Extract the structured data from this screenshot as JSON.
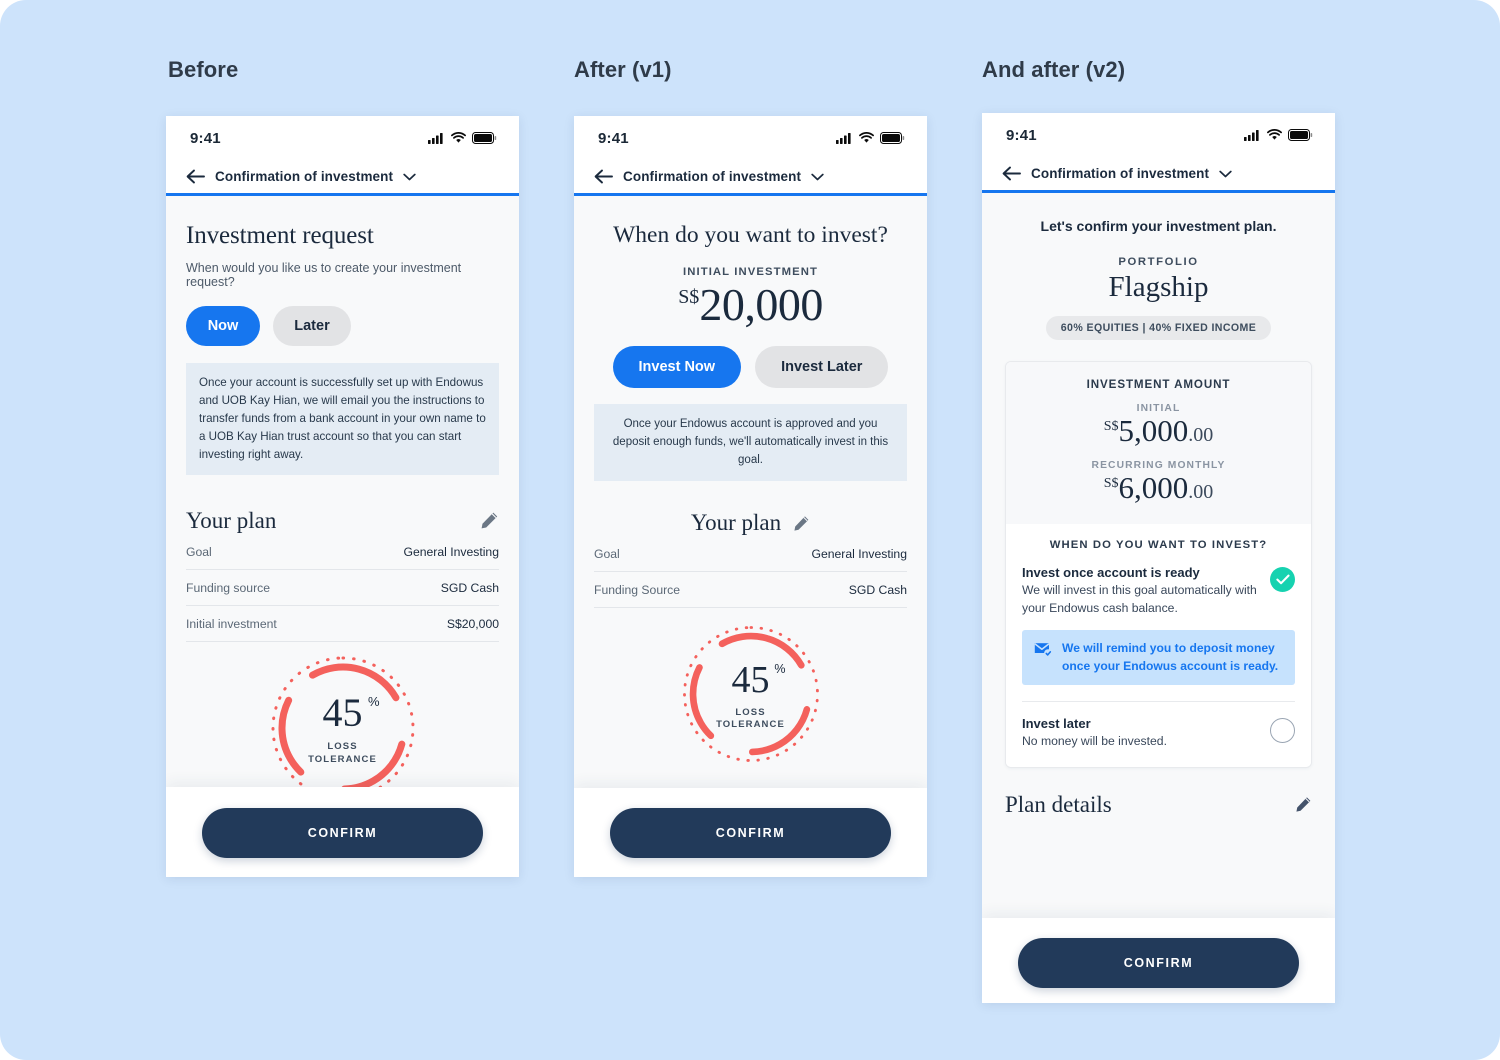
{
  "captions": {
    "before": "Before",
    "after_v1": "After (v1)",
    "after_v2": "And after (v2)"
  },
  "colors": {
    "page_background": "#cde3fb",
    "accent_blue": "#1676ef",
    "dark_navy": "#223a5a",
    "text_navy": "#1b2a3d",
    "dial_red": "#f4615c",
    "success_teal": "#16d2b0",
    "info_grey": "#e4ecf4",
    "remind_blue": "#c6e2fd"
  },
  "statusbar": {
    "time": "9:41",
    "icons": [
      "cellular-signal-icon",
      "wifi-icon",
      "battery-icon"
    ]
  },
  "navbar": {
    "back_icon": "back-arrow-icon",
    "title": "Confirmation of investment",
    "chevron_icon": "chevron-down-icon"
  },
  "phone1": {
    "heading": "Investment request",
    "subheading": "When would you like us to create your investment request?",
    "segments": [
      {
        "label": "Now",
        "selected": true
      },
      {
        "label": "Later",
        "selected": false
      }
    ],
    "info_text": "Once your account is successfully set up with Endowus and UOB Kay Hian, we will email you the instructions to transfer funds from a bank account in your own name to a UOB Kay Hian trust account so that you can start investing right away.",
    "plan_title": "Your plan",
    "edit_icon": "pencil-icon",
    "rows": [
      {
        "key": "Goal",
        "value": "General Investing"
      },
      {
        "key": "Funding source",
        "value": "SGD Cash"
      },
      {
        "key": "Initial investment",
        "value": "S$20,000"
      }
    ],
    "dial": {
      "value": "45",
      "unit": "%",
      "label_line1": "LOSS",
      "label_line2": "TOLERANCE"
    },
    "confirm_label": "CONFIRM"
  },
  "phone2": {
    "question": "When do you want to invest?",
    "amount_kicker": "INITIAL INVESTMENT",
    "amount_currency": "S$",
    "amount_value": "20,000",
    "segments": [
      {
        "label": "Invest Now",
        "selected": true
      },
      {
        "label": "Invest Later",
        "selected": false
      }
    ],
    "info_text": "Once your Endowus account is approved and you deposit enough funds, we'll automatically invest in this goal.",
    "plan_title": "Your plan",
    "edit_icon": "pencil-icon",
    "rows": [
      {
        "key": "Goal",
        "value": "General Investing"
      },
      {
        "key": "Funding Source",
        "value": "SGD Cash"
      }
    ],
    "dial": {
      "value": "45",
      "unit": "%",
      "label_line1": "LOSS",
      "label_line2": "TOLERANCE"
    },
    "confirm_label": "CONFIRM"
  },
  "phone3": {
    "lead": "Let's confirm your investment plan.",
    "portfolio_kicker": "PORTFOLIO",
    "portfolio_name": "Flagship",
    "allocation_chip": "60% EQUITIES | 40% FIXED INCOME",
    "amount_card_title": "INVESTMENT AMOUNT",
    "initial_label": "INITIAL",
    "initial_currency": "S$",
    "initial_value": "5,000",
    "initial_cents": ".00",
    "recurring_label": "RECURRING MONTHLY",
    "recurring_currency": "S$",
    "recurring_value": "6,000",
    "recurring_cents": ".00",
    "when_title": "WHEN DO YOU WANT TO INVEST?",
    "option_ready": {
      "title": "Invest once account is ready",
      "desc": "We will invest in this goal automatically with your Endowus cash balance.",
      "selected": true
    },
    "remind_icon": "envelope-check-icon",
    "remind_text": "We will remind you to deposit money once your Endowus account is ready.",
    "option_later": {
      "title": "Invest later",
      "desc": "No money will be invested.",
      "selected": false
    },
    "plan_details_title": "Plan details",
    "edit_icon": "pencil-icon",
    "confirm_label": "CONFIRM"
  }
}
